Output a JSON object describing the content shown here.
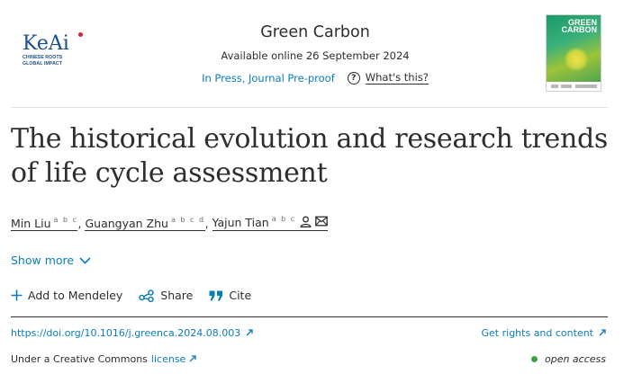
{
  "publisher": {
    "name": "KeAi",
    "tagline_line1": "CHINESE ROOTS",
    "tagline_line2": "GLOBAL IMPACT"
  },
  "journal": {
    "title": "Green Carbon",
    "available_online": "Available online 26 September 2024",
    "status": "In Press, Journal Pre-proof",
    "whats_this": "What's this?",
    "cover_title_line1": "GREEN",
    "cover_title_line2": "CARBON"
  },
  "article": {
    "title": "The historical evolution and research trends of life cycle assessment",
    "authors": [
      {
        "name": "Min Liu",
        "affil": "a b c"
      },
      {
        "name": "Guangyan Zhu",
        "affil": "a b c d"
      },
      {
        "name": "Yajun Tian",
        "affil": "a b c"
      }
    ],
    "separator": ","
  },
  "show_more": "Show more",
  "actions": {
    "mendeley": "Add to Mendeley",
    "share": "Share",
    "cite": "Cite"
  },
  "doi_link": "https://doi.org/10.1016/j.greenca.2024.08.003",
  "rights_link": "Get rights and content",
  "license": {
    "prefix": "Under a Creative Commons",
    "link": "license"
  },
  "open_access": "open access",
  "colors": {
    "link": "#0c7dbb",
    "text": "#2e2e2e",
    "brand": "#1b4f8a",
    "open_access_dot": "#3aa348"
  }
}
